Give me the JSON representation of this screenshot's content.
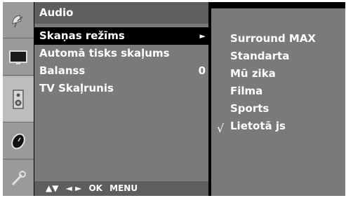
{
  "colors": {
    "background": "#000000",
    "panel": "#7a7a7a",
    "title_bar": "#5e5e5e",
    "text": "#ffffff"
  },
  "icons": [
    {
      "name": "satellite-dish-icon",
      "selected": false
    },
    {
      "name": "tv-screen-icon",
      "selected": false
    },
    {
      "name": "speaker-icon",
      "selected": true
    },
    {
      "name": "clock-icon",
      "selected": false
    },
    {
      "name": "wrench-icon",
      "selected": false
    }
  ],
  "menu": {
    "title": "Audio",
    "items": [
      {
        "label": "Skaņas režīms",
        "value": "",
        "arrow": "►",
        "active": true
      },
      {
        "label": "Automā tisks skaļums",
        "value": "",
        "arrow": "",
        "active": false
      },
      {
        "label": "Balanss",
        "value": "0",
        "arrow": "",
        "active": false
      },
      {
        "label": "TV Skaļrunis",
        "value": "",
        "arrow": "",
        "active": false
      }
    ],
    "nav": {
      "updown": "▲▼",
      "leftright": "◄ ►",
      "ok": "OK",
      "menu": "MENU"
    }
  },
  "submenu": {
    "items": [
      "Surround MAX",
      "Standarta",
      "Mū zika",
      "Filma",
      "Sports",
      "Lietotā js"
    ],
    "selected_index": 5,
    "check_mark": "√"
  }
}
